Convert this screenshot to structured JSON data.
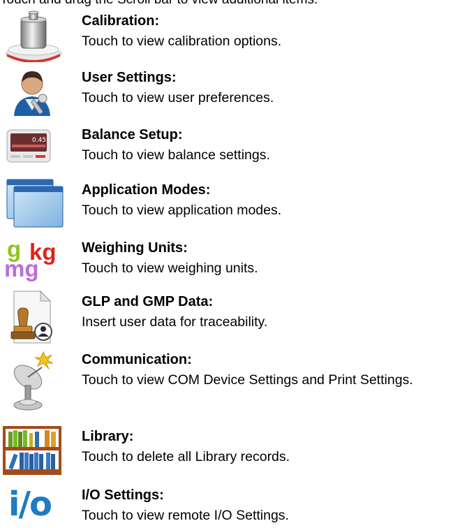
{
  "intro": "Touch and drag the Scroll bar to view additional items.",
  "items": [
    {
      "title": "Calibration:",
      "desc": "Touch to view calibration options.",
      "icon": "calibration-weight-icon"
    },
    {
      "title": "User Settings:",
      "desc": "Touch to view user preferences.",
      "icon": "user-settings-icon"
    },
    {
      "title": "Balance Setup:",
      "desc": "Touch to view balance settings.",
      "icon": "balance-setup-icon",
      "display_value": "0.45"
    },
    {
      "title": "Application Modes:",
      "desc": "Touch to view application modes.",
      "icon": "application-modes-icon"
    },
    {
      "title": "Weighing Units:",
      "desc": "Touch to view weighing units.",
      "icon": "weighing-units-icon",
      "unit_labels": [
        "g",
        "kg",
        "mg"
      ]
    },
    {
      "title": "GLP and GMP Data:",
      "desc": "Insert user data for traceability.",
      "icon": "glp-gmp-icon"
    },
    {
      "title": "Communication:",
      "desc": "Touch to view COM Device Settings and Print Settings.",
      "icon": "communication-icon"
    },
    {
      "title": "Library:",
      "desc": "Touch to delete all Library records.",
      "icon": "library-icon"
    },
    {
      "title": "I/O Settings:",
      "desc": "Touch to view remote I/O Settings.",
      "icon": "io-settings-icon",
      "icon_text": "i/o"
    }
  ]
}
